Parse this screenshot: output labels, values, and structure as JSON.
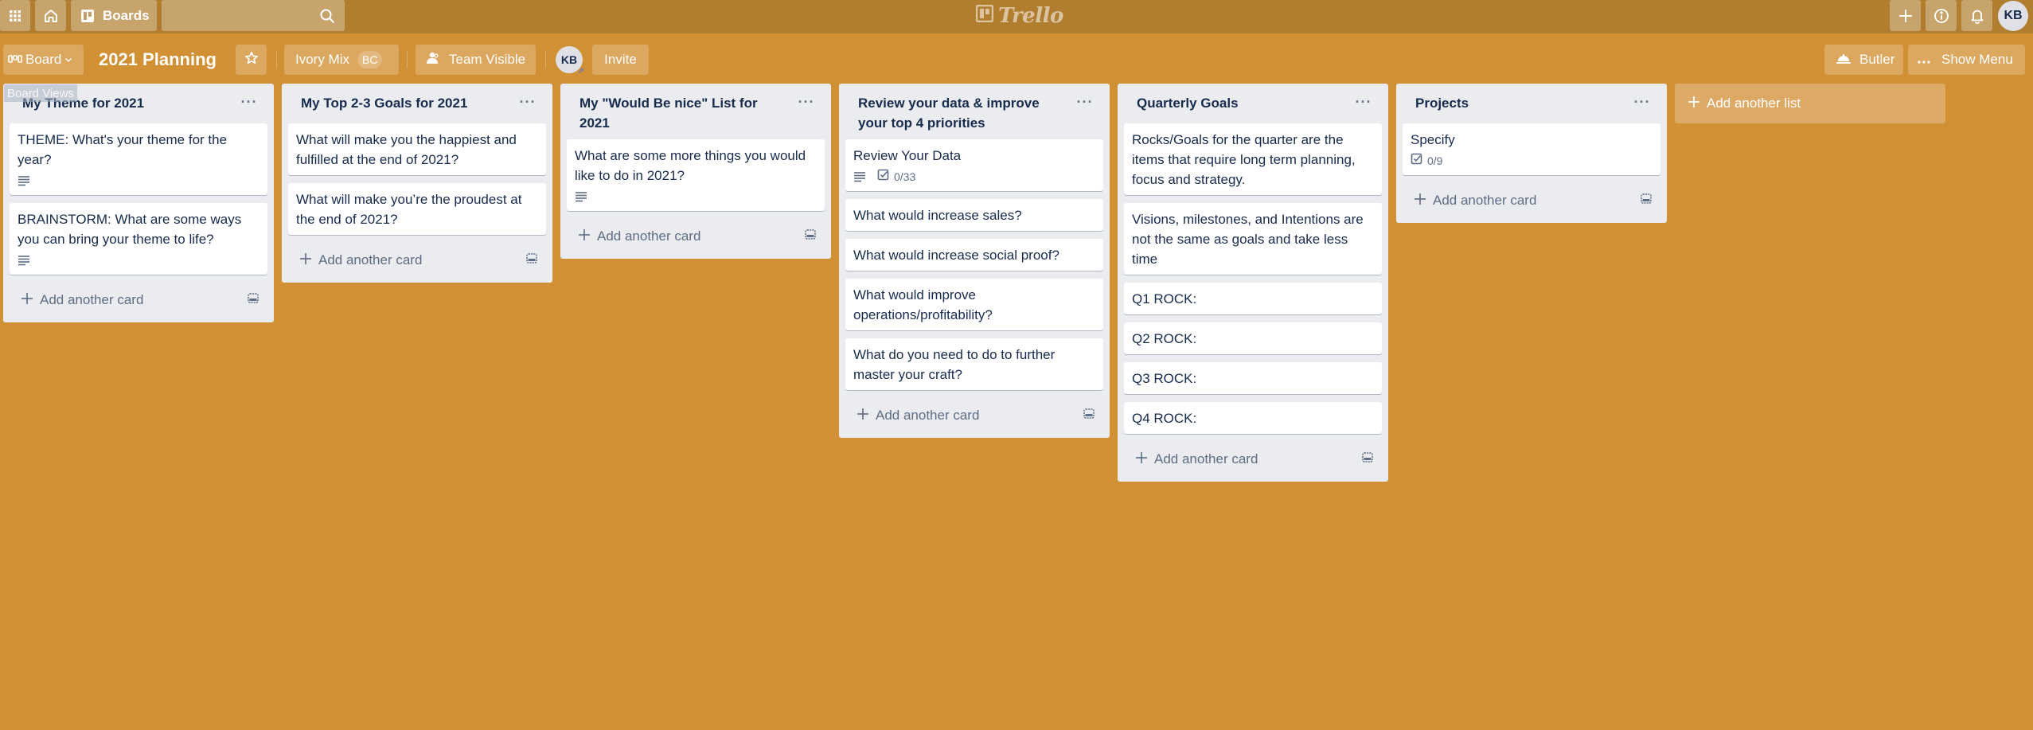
{
  "topbar": {
    "apps_icon": "apps-grid-icon",
    "home_icon": "home-icon",
    "boards_label": "Boards",
    "search_placeholder": "",
    "logo_text": "Trello",
    "create_icon": "plus-icon",
    "info_icon": "info-icon",
    "notifications_icon": "bell-icon",
    "user_initials": "KB"
  },
  "board_header": {
    "view_switcher_label": "Board",
    "board_title": "2021 Planning",
    "team_name": "Ivory Mix",
    "team_badge": "BC",
    "visibility_label": "Team Visible",
    "member_initials": "KB",
    "invite_label": "Invite",
    "butler_label": "Butler",
    "show_menu_label": "Show Menu",
    "tooltip": "Board Views"
  },
  "colors": {
    "topbar_bg": "#B17D2F",
    "board_bg": "#D29034",
    "list_bg": "#EBECF0",
    "card_bg": "#FFFFFF",
    "text": "#172B4D",
    "muted_text": "#5E6C84"
  },
  "lists": [
    {
      "title": "My Theme for 2021",
      "cards": [
        {
          "title": "THEME: What's your theme for the year?",
          "has_description": true
        },
        {
          "title": "BRAINSTORM: What are some ways you can bring your theme to life?",
          "has_description": true
        }
      ],
      "add_card_label": "Add another card"
    },
    {
      "title": "My Top 2-3 Goals for 2021",
      "cards": [
        {
          "title": "What will make you the happiest and fulfilled at the end of 2021?"
        },
        {
          "title": "What will make you’re the proudest at the end of 2021?"
        }
      ],
      "add_card_label": "Add another card"
    },
    {
      "title": "My \"Would Be nice\" List for 2021",
      "cards": [
        {
          "title": "What are some more things you would like to do in 2021?",
          "has_description": true
        }
      ],
      "add_card_label": "Add another card"
    },
    {
      "title": "Review your data & improve your top 4 priorities",
      "cards": [
        {
          "title": "Review Your Data",
          "has_description": true,
          "checklist": "0/33"
        },
        {
          "title": "What would increase sales?"
        },
        {
          "title": "What would increase social proof?"
        },
        {
          "title": "What would improve operations/profitability?"
        },
        {
          "title": "What do you need to do to further master your craft?"
        }
      ],
      "add_card_label": "Add another card"
    },
    {
      "title": "Quarterly Goals",
      "cards": [
        {
          "title": "Rocks/Goals for the quarter are the items that require long term planning, focus and strategy."
        },
        {
          "title": "Visions, milestones, and Intentions are not the same as goals and take less time"
        },
        {
          "title": "Q1 ROCK:"
        },
        {
          "title": "Q2 ROCK:"
        },
        {
          "title": "Q3 ROCK:"
        },
        {
          "title": "Q4 ROCK:"
        }
      ],
      "add_card_label": "Add another card"
    },
    {
      "title": "Projects",
      "cards": [
        {
          "title": "Specify",
          "checklist": "0/9"
        }
      ],
      "add_card_label": "Add another card"
    }
  ],
  "add_list_label": "Add another list"
}
